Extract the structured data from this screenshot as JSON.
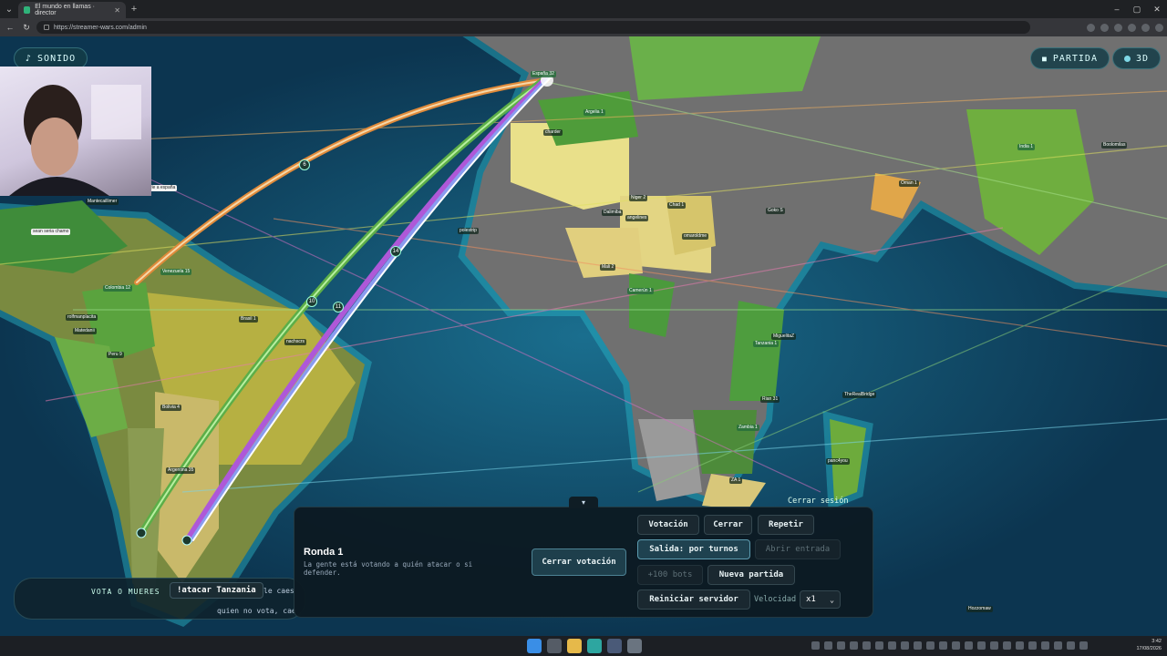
{
  "browser": {
    "tab_title": "El mundo en llamas · director",
    "url": "https://streamer-wars.com/admin"
  },
  "top_controls": {
    "sound_label": "SONIDO",
    "match_label": "PARTIDA",
    "view3d_label": "3D"
  },
  "map_labels": {
    "espana": "España 32",
    "argelia": "Argelia 1",
    "niger": "Niger 2",
    "chad": "Chad 1",
    "india": "India 1",
    "oman": "Oman 1",
    "tanzania": "Tanzania 1",
    "brasil": "Brasil 1",
    "venezuela": "Venezuela 15",
    "colombia": "Colombia 12",
    "argentina": "Argentina 35",
    "bolivia": "Bolivia 4",
    "peru": "Peru 9",
    "camerun": "Camerún 1",
    "mali": "Mali 2",
    "zambia": "Zambia 1",
    "za": "ZA 1",
    "chat_bubble_1": "arle a españa",
    "chat_bubble_2": "sean seria chamo",
    "users": [
      "polestrip",
      "charder",
      "Dalimiba",
      "angelines",
      "omaroldme",
      "MiguelitaZ",
      "Rian 31",
      "TheRealBridge",
      "panc4you",
      "Hozzomaw",
      "Brasil 1",
      "nachscrs",
      "Boolomilas",
      "Goko S",
      "Matedanii",
      "rolfmanplacita",
      "Mantecaillimer"
    ]
  },
  "route_counts": [
    "6",
    "10",
    "11",
    "14"
  ],
  "vote_bar": {
    "label": "VOTA O MUERES",
    "command": "!atacar Tanzania",
    "line1": "le caes",
    "line2": "quien no vota, cae"
  },
  "panel": {
    "logout": "Cerrar sesión",
    "round_title": "Ronda 1",
    "round_desc": "La gente está votando a quién atacar o si defender.",
    "close_vote": "Cerrar votación",
    "buttons": {
      "votacion": "Votación",
      "cerrar": "Cerrar",
      "repetir": "Repetir",
      "salida": "Salida: por turnos",
      "abrir_entrada": "Abrir entrada",
      "bots": "+100 bots",
      "nueva_partida": "Nueva partida",
      "reiniciar": "Reiniciar servidor"
    },
    "speed_label": "Velocidad",
    "speed_value": "x1"
  },
  "taskbar": {
    "time": "3:42",
    "date": "17/08/2026"
  },
  "colors": {
    "ocean": "#0f4a6a",
    "land_gray": "#6e6e6e",
    "land_green": "#5aa33e",
    "land_yellow": "#e8e090",
    "route_orange": "#e0883a",
    "route_green": "#6cc45a",
    "route_purple": "#b05ad8"
  }
}
